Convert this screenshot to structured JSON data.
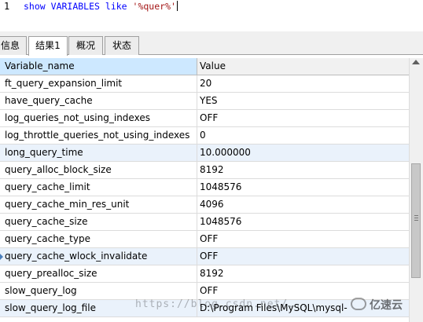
{
  "editor": {
    "line_number": "1",
    "sql_kw1": "show",
    "sql_kw2": "VARIABLES",
    "sql_kw3": "like",
    "sql_str": "'%quer%'"
  },
  "tabs": [
    {
      "label": "信息",
      "active": false
    },
    {
      "label": "结果1",
      "active": true
    },
    {
      "label": "概况",
      "active": false
    },
    {
      "label": "状态",
      "active": false
    }
  ],
  "grid": {
    "columns": [
      "Variable_name",
      "Value"
    ],
    "rows": [
      [
        "ft_query_expansion_limit",
        "20"
      ],
      [
        "have_query_cache",
        "YES"
      ],
      [
        "log_queries_not_using_indexes",
        "OFF"
      ],
      [
        "log_throttle_queries_not_using_indexes",
        "0"
      ],
      [
        "long_query_time",
        "10.000000"
      ],
      [
        "query_alloc_block_size",
        "8192"
      ],
      [
        "query_cache_limit",
        "1048576"
      ],
      [
        "query_cache_min_res_unit",
        "4096"
      ],
      [
        "query_cache_size",
        "1048576"
      ],
      [
        "query_cache_type",
        "OFF"
      ],
      [
        "query_cache_wlock_invalidate",
        "OFF"
      ],
      [
        "query_prealloc_size",
        "8192"
      ],
      [
        "slow_query_log",
        "OFF"
      ],
      [
        "slow_query_log_file",
        "D:\\Program Files\\MySQL\\mysql-"
      ]
    ]
  },
  "watermark": "https://blog.csdn.net/...",
  "brand": "亿速云"
}
